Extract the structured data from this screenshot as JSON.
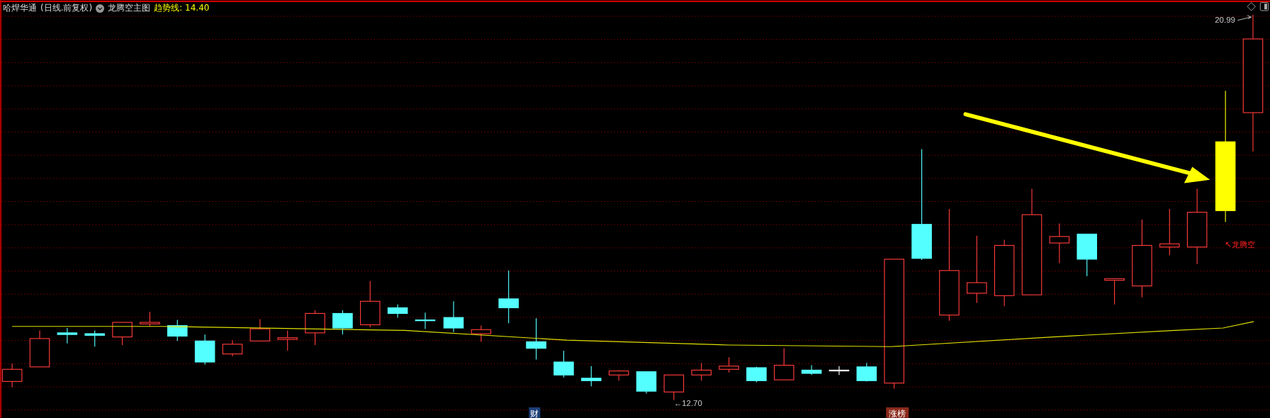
{
  "header": {
    "stock_name": "哈焊华通",
    "period": "(日线.前复权)",
    "indicator_name": "龙腾空主图",
    "trend_line": "趋势线: 14.40"
  },
  "chart": {
    "high_label": "20.99",
    "low_label": "←12.70",
    "signal_label": "↖龙腾空",
    "markers": [
      {
        "text": "财",
        "kind": "finance"
      },
      {
        "text": "涨榜",
        "kind": "limit_up"
      }
    ]
  }
}
